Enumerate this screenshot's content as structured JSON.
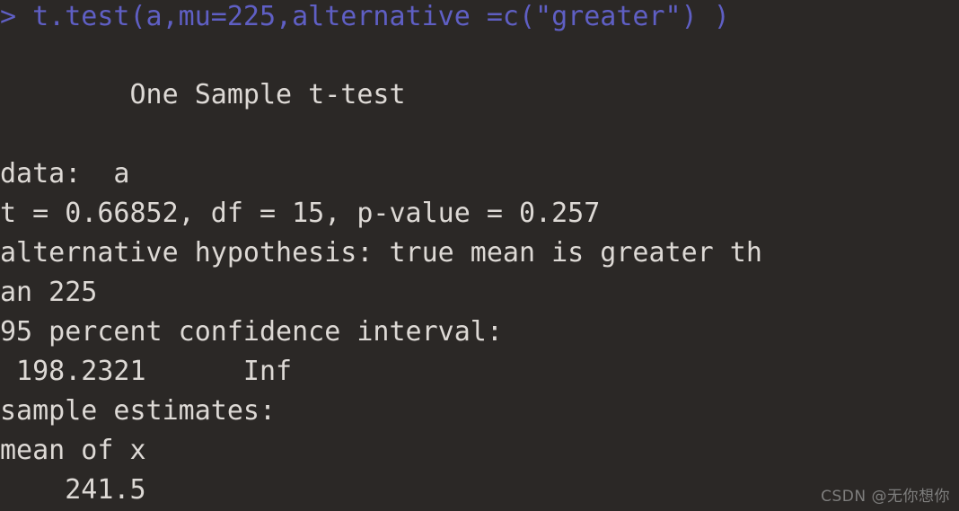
{
  "terminal": {
    "background_color": "#2b2826",
    "command_color": "#5f5fc4",
    "output_color": "#ddd9d5",
    "prompt_symbol": "> ",
    "command_line": "> t.test(a,mu=225,alternative =c(\"greater\") )",
    "title_line": "        One Sample t-test",
    "blank_line": "",
    "output_lines": [
      "data:  a",
      "t = 0.66852, df = 15, p-value = 0.257",
      "alternative hypothesis: true mean is greater th",
      "an 225",
      "95 percent confidence interval:",
      " 198.2321      Inf",
      "sample estimates:",
      "mean of x",
      "    241.5"
    ]
  },
  "test_results": {
    "test_name": "One Sample t-test",
    "data_label": "data:",
    "data_value": "a",
    "t_statistic": "0.66852",
    "df": "15",
    "p_value": "0.257",
    "alternative_hypothesis": "true mean is greater than 225",
    "mu": "225",
    "alternative_arg": "greater",
    "confidence_level": "95 percent",
    "ci_lower": "198.2321",
    "ci_upper": "Inf",
    "sample_estimate_label": "mean of x",
    "sample_estimate_value": "241.5"
  },
  "watermark": {
    "text": "CSDN @无你想你",
    "color": "#8d8d8d"
  }
}
